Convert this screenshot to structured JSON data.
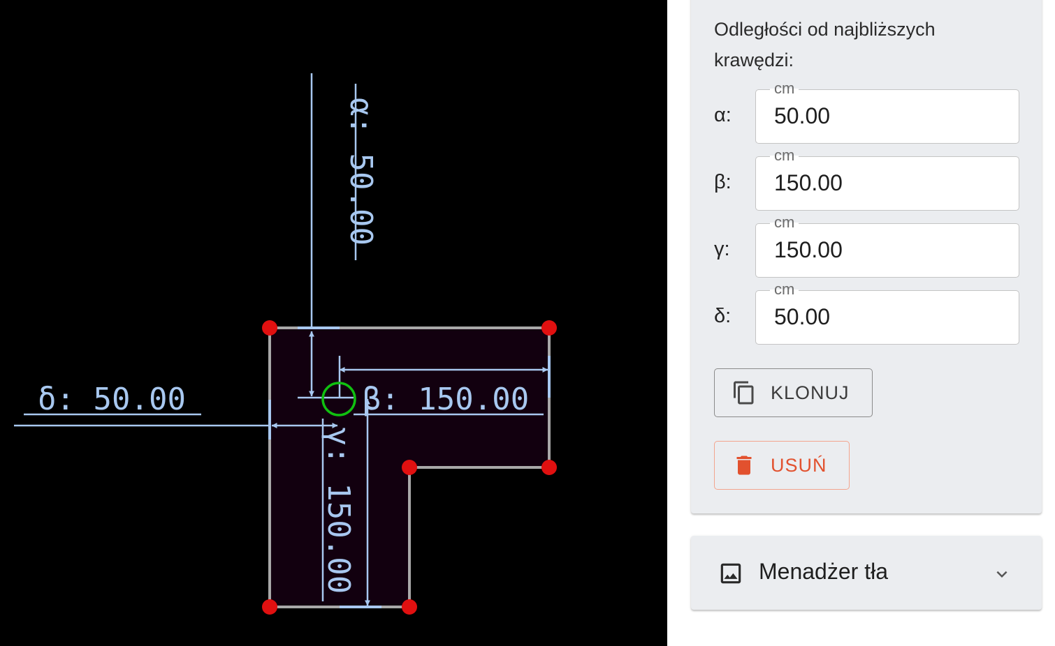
{
  "canvas": {
    "labels": {
      "alpha": "α: 50.00",
      "beta": "β: 150.00",
      "gamma": "γ: 150.00",
      "delta": "δ: 50.00"
    },
    "colors": {
      "dimension": "#a8c8f0",
      "shape_edge": "#a8a8a8",
      "shape_fill": "#12000f",
      "vertex": "#e01010",
      "anchor": "#10c010"
    }
  },
  "properties": {
    "label": "Odległości od najbliższych krawędzi:",
    "fields": [
      {
        "label": "α:",
        "unit": "cm",
        "value": "50.00"
      },
      {
        "label": "β:",
        "unit": "cm",
        "value": "150.00"
      },
      {
        "label": "γ:",
        "unit": "cm",
        "value": "150.00"
      },
      {
        "label": "δ:",
        "unit": "cm",
        "value": "50.00"
      }
    ],
    "clone_button": {
      "label": "KLONUJ",
      "icon": "copy-icon"
    },
    "delete_button": {
      "label": "USUŃ",
      "icon": "trash-icon",
      "color": "#e2512e"
    }
  },
  "background_manager": {
    "title": "Menadżer tła",
    "icon": "image-icon",
    "expand_icon": "chevron-down-icon"
  }
}
